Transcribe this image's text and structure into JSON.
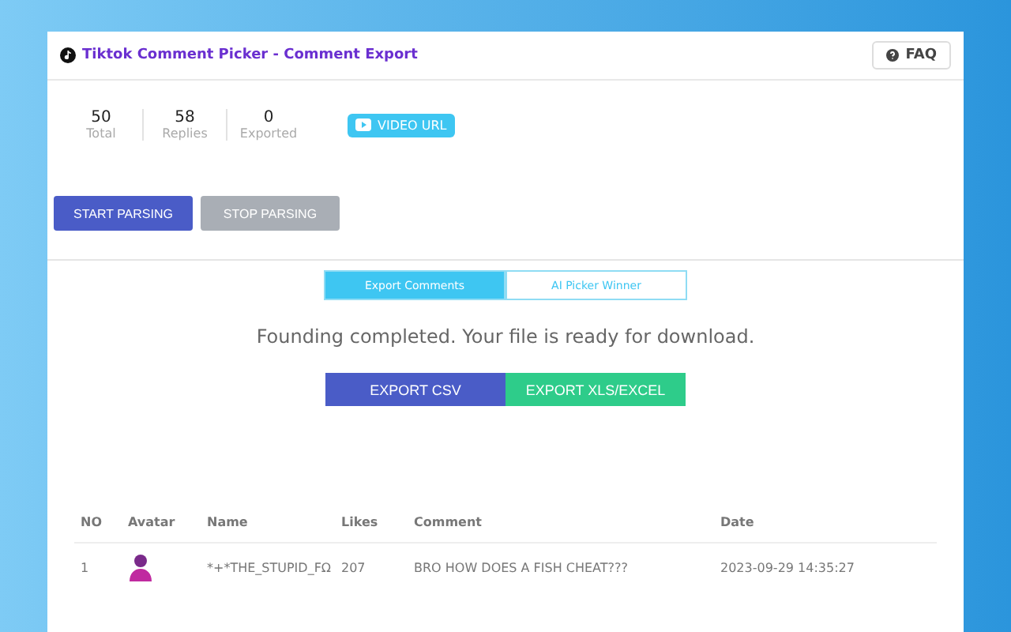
{
  "header": {
    "title": "Tiktok Comment Picker - Comment Export",
    "faq": "FAQ"
  },
  "stats": [
    {
      "value": "50",
      "label": "Total"
    },
    {
      "value": "58",
      "label": "Replies"
    },
    {
      "value": "0",
      "label": "Exported"
    }
  ],
  "video_url": "VIDEO URL",
  "parse_buttons": [
    {
      "label": "START PARSING",
      "disabled": false
    },
    {
      "label": "STOP PARSING",
      "disabled": true
    }
  ],
  "tabs": [
    {
      "label": "Export Comments",
      "selected": true
    },
    {
      "label": "AI Picker Winner",
      "selected": false
    }
  ],
  "message": "Founding completed. Your file is ready for download.",
  "export_buttons": [
    {
      "label": "EXPORT CSV",
      "color": "#4a5cc7"
    },
    {
      "label": "EXPORT XLS/EXCEL",
      "color": "#2ecc8a"
    }
  ],
  "table": {
    "columns": [
      "NO",
      "Avatar",
      "Name",
      "Likes",
      "Comment",
      "Date"
    ],
    "rows": [
      {
        "no": "1",
        "name": "*+*THE_STUPID_FΩ",
        "likes": "207",
        "comment": "BRO HOW DOES A FISH CHEAT???",
        "date": "2023-09-29 14:35:27"
      }
    ]
  }
}
